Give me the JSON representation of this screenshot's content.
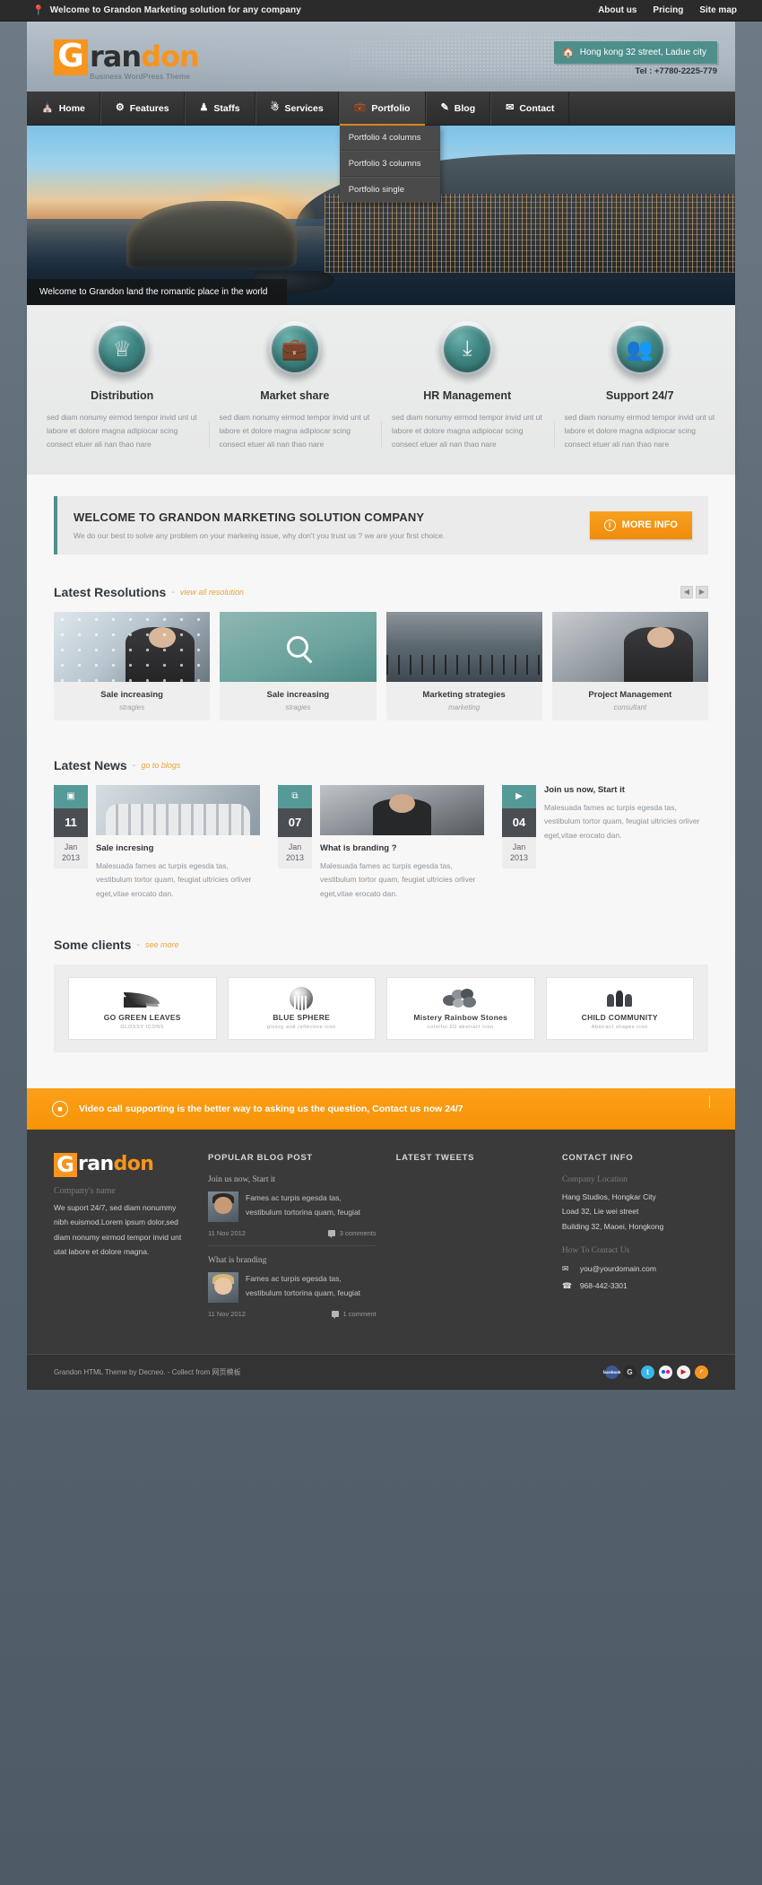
{
  "topbar": {
    "pin_icon": "location-pin-icon",
    "welcome": "Welcome to Grandon Marketing solution for any company",
    "links": [
      "About us",
      "Pricing",
      "Site map"
    ]
  },
  "header": {
    "logo": {
      "letter": "G",
      "part1": "ran",
      "part2": "don",
      "tagline": "Business WordPress Theme"
    },
    "address": "Hong kong 32 street, Ladue city",
    "address_icon": "home-icon",
    "tel": "Tel : +7780-2225-779"
  },
  "nav": {
    "items": [
      {
        "label": "Home",
        "icon": "home-icon",
        "glyph": "⌂",
        "active": false
      },
      {
        "label": "Features",
        "icon": "gear-icon",
        "glyph": "⚙",
        "active": false
      },
      {
        "label": "Staffs",
        "icon": "user-icon",
        "glyph": "♟",
        "active": false
      },
      {
        "label": "Services",
        "icon": "bulb-icon",
        "glyph": "♈",
        "active": false
      },
      {
        "label": "Portfolio",
        "icon": "briefcase-icon",
        "glyph": "✉",
        "active": true
      },
      {
        "label": "Blog",
        "icon": "pencil-icon",
        "glyph": "✎",
        "active": false
      },
      {
        "label": "Contact",
        "icon": "mail-icon",
        "glyph": "✉",
        "active": false
      }
    ],
    "dropdown": [
      "Portfolio 4 columns",
      "Portfolio 3 columns",
      "Portfolio single"
    ]
  },
  "hero": {
    "caption": "Welcome to Grandon land the romantic place in the world"
  },
  "features": [
    {
      "title": "Distribution",
      "icon": "trophy-icon",
      "glyph": "♛",
      "text": "sed diam nonumy eirmod tempor invid unt ut labore et dolore magna adipiocar scing consect etuer ali nan thao nare"
    },
    {
      "title": "Market share",
      "icon": "briefcase-icon",
      "glyph": "▤",
      "text": "sed diam nonumy eirmod tempor invid unt ut labore et dolore magna adipiocar scing consect etuer ali nan thao nare"
    },
    {
      "title": "HR Management",
      "icon": "download-inbox-icon",
      "glyph": "⤓",
      "text": "sed diam nonumy eirmod tempor invid unt ut labore et dolore magna adipiocar scing consect etuer ali nan thao nare"
    },
    {
      "title": "Support 24/7",
      "icon": "users-icon",
      "glyph": "♟",
      "text": "sed diam nonumy eirmod tempor invid unt ut labore et dolore magna adipiocar scing consect etuer ali nan thao nare"
    }
  ],
  "welcome_box": {
    "title": "WELCOME TO GRANDON MARKETING SOLUTION COMPANY",
    "subtitle": "We do our best to solve any problem on your markeing issue, why don't you trust us ? we are your first choice.",
    "button": "MORE INFO",
    "button_icon": "info-circle-icon"
  },
  "resolutions": {
    "title": "Latest Resolutions",
    "dash": "-",
    "link": "view all resolution",
    "prev_icon": "chevron-left-icon",
    "next_icon": "chevron-right-icon",
    "prev_glyph": "◀",
    "next_glyph": "▶",
    "items": [
      {
        "name": "Sale increasing",
        "tag": "stragies"
      },
      {
        "name": "Sale increasing",
        "tag": "stragies"
      },
      {
        "name": "Marketing strategies",
        "tag": "marketing"
      },
      {
        "name": "Project Management",
        "tag": "consultant"
      }
    ]
  },
  "news": {
    "title": "Latest News",
    "dash": "-",
    "link": "go to blogs",
    "items": [
      {
        "day": "11",
        "month": "Jan",
        "year": "2013",
        "icon": "image-icon",
        "icon_glyph": "▣",
        "title": "Sale incresing",
        "text": "Malesuada fames ac turpis egesda tas, vestibulum tortor quam, feugiat ultricies orliver eget,vitae erocato dan."
      },
      {
        "day": "07",
        "month": "Jan",
        "year": "2013",
        "icon": "gallery-icon",
        "icon_glyph": "⧉",
        "title": "What is branding ?",
        "text": "Malesuada fames ac turpis egesda tas, vestibulum tortor quam, feugiat ultricies orliver eget,vitae erocato dan."
      },
      {
        "day": "04",
        "month": "Jan",
        "year": "2013",
        "icon": "video-icon",
        "icon_glyph": "▶",
        "title": "Join us now, Start it",
        "text": "Malesuada fames ac turpis egesda tas, vestibulum tortor quam, feugiat ultricies orliver eget,vitae erocato dan."
      }
    ]
  },
  "clients": {
    "title": "Some clients",
    "dash": "-",
    "link": "see more",
    "items": [
      {
        "name": "GO GREEN LEAVES",
        "sub": "GLOSSY ICONS",
        "mark": "leaf-logo-icon"
      },
      {
        "name": "BLUE SPHERE",
        "sub": "glossy and reflective icon",
        "mark": "sphere-logo-icon"
      },
      {
        "name": "Mistery Rainbow Stones",
        "sub": "colorful 2D abstract icon",
        "mark": "stones-logo-icon"
      },
      {
        "name": "CHILD COMMUNITY",
        "sub": "Abstract shapes icon",
        "mark": "people-logo-icon"
      }
    ]
  },
  "cta": {
    "icon": "video-camera-icon",
    "glyph": "■",
    "text": "Video call supporting is the better way to asking us the question, Contact us now 24/7"
  },
  "footer": {
    "brand": {
      "letter": "G",
      "part1": "ran",
      "part2": "don",
      "sub_title": "Company's name",
      "body": "We suport 24/7, sed diam nonummy nibh euismod.Lorem ipsum dolor,sed diam nonumy eirmod tempor invid unt utat labore et dolore magna."
    },
    "blog": {
      "heading": "POPULAR BLOG POST",
      "posts": [
        {
          "title": "Join us now, Start it",
          "text": "Fames ac turpis egesda tas, vestibulum tortorina quam, feugiat",
          "date": "11 Nov 2012",
          "comments": "3 comments",
          "comment_icon": "comment-icon"
        },
        {
          "title": "What is branding",
          "text": "Fames ac turpis egesda tas, vestibulum tortorina quam, feugiat",
          "date": "11 Nov 2012",
          "comments": "1 comment",
          "comment_icon": "comment-icon"
        }
      ]
    },
    "tweets": {
      "heading": "LATEST TWEETS"
    },
    "contact": {
      "heading": "CONTACT INFO",
      "location_label": "Company Location",
      "location_lines": [
        "Hang Studios, Hongkar City",
        "Load 32, Lie wei street",
        "Building 32, Maoei, Hongkong"
      ],
      "how_label": "How To Contact Us",
      "email": "you@yourdomain.com",
      "email_icon": "mail-icon",
      "email_glyph": "✉",
      "phone": "968-442-3301",
      "phone_icon": "phone-icon",
      "phone_glyph": "☎"
    }
  },
  "bottombar": {
    "copyright": "Grandon HTML Theme by Decneo. - Collect from 网页模板",
    "socials": [
      {
        "name": "facebook-icon",
        "glyph": "facebook",
        "cls": "fb"
      },
      {
        "name": "google-plus-icon",
        "glyph": "G",
        "cls": "gp"
      },
      {
        "name": "twitter-icon",
        "glyph": "t",
        "cls": "tw"
      },
      {
        "name": "flickr-icon",
        "glyph": "",
        "cls": "fl"
      },
      {
        "name": "youtube-icon",
        "glyph": "▶",
        "cls": "yt"
      },
      {
        "name": "rss-icon",
        "glyph": "◜",
        "cls": "rss"
      }
    ]
  },
  "colors": {
    "accent_orange": "#f7941d",
    "teal": "#4e8f8c",
    "dark": "#2b2b2b"
  }
}
